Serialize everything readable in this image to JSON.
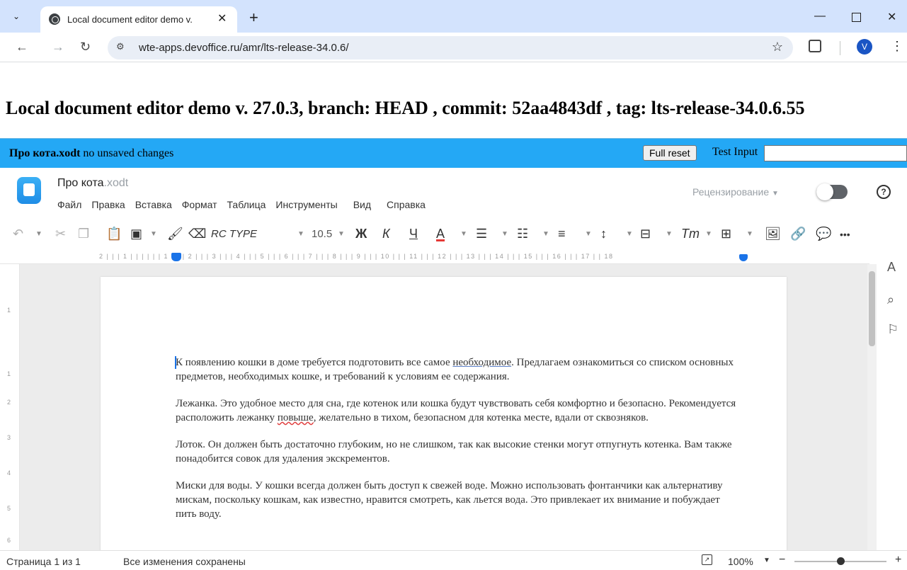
{
  "browser": {
    "tab_title": "Local document editor demo v.",
    "url": "wte-apps.devoffice.ru/amr/lts-release-34.0.6/",
    "avatar_letter": "V"
  },
  "page": {
    "heading": "Local document editor demo v. 27.0.3, branch: HEAD , commit: 52aa4843df , tag: lts-release-34.0.6.55",
    "file_name": "Про кота.xodt",
    "file_status": " no unsaved changes",
    "reset_button": "Full reset",
    "test_input_label": "Test Input",
    "test_input_value": ""
  },
  "editor": {
    "doc_title": "Про кота",
    "doc_ext": ".xodt",
    "menu": [
      "Файл",
      "Правка",
      "Вставка",
      "Формат",
      "Таблица",
      "Инструменты",
      "Вид",
      "Справка"
    ],
    "review_label": "Рецензирование",
    "toolbar": {
      "font_name": "RC TYPE",
      "font_size": "10.5",
      "bold": "Ж",
      "italic": "К",
      "underline": "Ч",
      "font_color": "A",
      "text_style": "Тт",
      "more": "•••"
    },
    "ruler_ticks": "2 | | | 1 | | |   | | | 1 | | | 2 | | | 3 | | | 4 | | | 5 | | | 6 | | | 7 | | | 8 | | | 9 | | | 10 | | | 11 | | | 12 | | | 13 | | | 14 | | | 15 | | | 16 | | | 17   | | 18",
    "vruler_numbers": [
      "1",
      "1",
      "2",
      "3",
      "4",
      "5",
      "6"
    ],
    "document": {
      "p1_before": "К появлению кошки в доме требуется подготовить все самое ",
      "p1_underlined": "необходимое",
      "p1_after": ". Предлагаем ознакомиться со списком основных предметов, необходимых кошке, и требований к условиям ее содержания.",
      "p2_before": "Лежанка. Это удобное место для сна, где котенок или кошка будут чувствовать себя комфортно и безопасно. Рекомендуется расположить лежанку ",
      "p2_underlined": "повыше",
      "p2_after": ", желательно в тихом, безопасном для котенка месте, вдали от сквозняков.",
      "p3": "Лоток. Он должен быть достаточно глубоким, но не слишком, так как высокие стенки могут отпугнуть котенка. Вам также понадобится совок для удаления экскрементов.",
      "p4": "Миски для воды. У кошки всегда должен быть доступ к свежей воде. Можно использовать фонтанчики как альтернативу мискам, поскольку кошкам, как известно, нравится смотреть, как льется вода. Это привлекает их внимание и побуждает пить воду."
    },
    "status": {
      "page_info": "Страница 1 из 1",
      "saved": "Все изменения сохранены",
      "zoom": "100%",
      "zoom_level_fraction": 0.5
    }
  },
  "colors": {
    "tabbar_bg": "#d3e3fd",
    "blue_bar": "#24a8f5",
    "accent": "#1a73e8"
  }
}
